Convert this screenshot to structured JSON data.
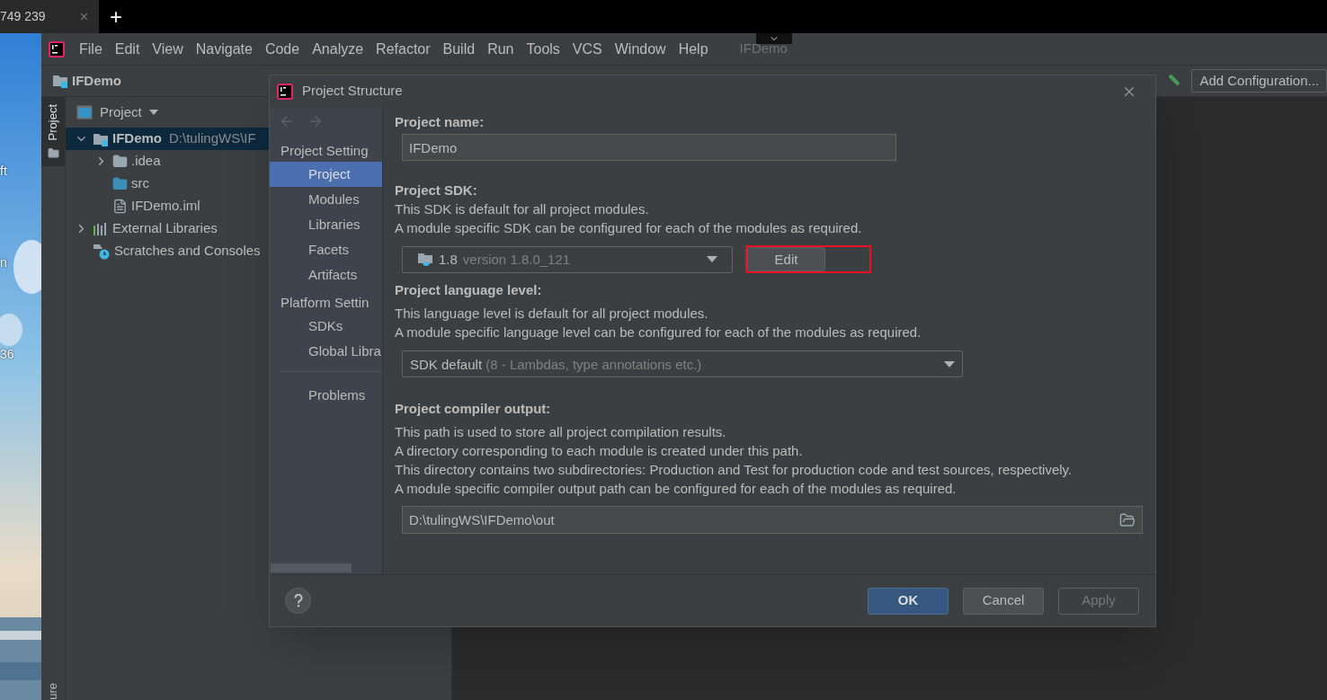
{
  "browser_tab": {
    "title": "749 239",
    "close": "×",
    "new_tab": "+"
  },
  "desktop_labels": [
    "ft",
    "n",
    "36"
  ],
  "menu_bar": {
    "items": [
      "File",
      "Edit",
      "View",
      "Navigate",
      "Code",
      "Analyze",
      "Refactor",
      "Build",
      "Run",
      "Tools",
      "VCS",
      "Window",
      "Help"
    ],
    "title": "IFDemo"
  },
  "nav_bar": {
    "project": "IFDemo",
    "run_config": "Add Configuration..."
  },
  "tool_windows": {
    "top": [
      {
        "label": "Project",
        "selected": true
      }
    ],
    "bottom": [
      {
        "label": "ure",
        "selected": false
      }
    ]
  },
  "project_panel": {
    "title": "Project",
    "tree": [
      {
        "name": "IFDemo",
        "path": "D:\\tulingWS\\IF",
        "kind": "module",
        "expanded": true,
        "selected": true,
        "children": [
          {
            "name": ".idea",
            "kind": "folder",
            "expanded": false,
            "selected": false
          },
          {
            "name": "src",
            "kind": "source",
            "selected": false
          },
          {
            "name": "IFDemo.iml",
            "kind": "file",
            "selected": false
          }
        ]
      },
      {
        "name": "External Libraries",
        "kind": "libraries",
        "expanded": false,
        "selected": false
      },
      {
        "name": "Scratches and Consoles",
        "kind": "scratches",
        "selected": false
      }
    ]
  },
  "dialog": {
    "title": "Project Structure",
    "sidebar": [
      {
        "header": "Project Setting",
        "items": [
          {
            "label": "Project",
            "selected": true
          },
          {
            "label": "Modules",
            "selected": false
          },
          {
            "label": "Libraries",
            "selected": false
          },
          {
            "label": "Facets",
            "selected": false
          },
          {
            "label": "Artifacts",
            "selected": false
          }
        ]
      },
      {
        "header": "Platform Settin",
        "items": [
          {
            "label": "SDKs",
            "selected": false
          },
          {
            "label": "Global Libra",
            "selected": false
          }
        ]
      },
      {
        "items": [
          {
            "label": "Problems",
            "selected": false
          }
        ]
      }
    ],
    "project_name": {
      "label": "Project name:",
      "value": "IFDemo"
    },
    "sdk": {
      "label": "Project SDK:",
      "description": [
        "This SDK is default for all project modules.",
        "A module specific SDK can be configured for each of the modules as required."
      ],
      "value": "1.8",
      "detail": "version 1.8.0_121",
      "edit_button": "Edit",
      "annotated": true
    },
    "language_level": {
      "label": "Project language level:",
      "description": [
        "This language level is default for all project modules.",
        "A module specific language level can be configured for each of the modules as required."
      ],
      "value": "SDK default",
      "detail": "(8 - Lambdas, type annotations etc.)"
    },
    "compiler_output": {
      "label": "Project compiler output:",
      "description": [
        "This path is used to store all project compilation results.",
        "A directory corresponding to each module is created under this path.",
        "This directory contains two subdirectories: Production and Test for production code and test sources, respectively.",
        "A module specific compiler output path can be configured for each of the modules as required."
      ],
      "value": "D:\\tulingWS\\IFDemo\\out"
    },
    "buttons": [
      {
        "label": "OK",
        "default": true,
        "disabled": false
      },
      {
        "label": "Cancel",
        "default": false,
        "disabled": false
      },
      {
        "label": "Apply",
        "default": false,
        "disabled": true
      }
    ]
  }
}
